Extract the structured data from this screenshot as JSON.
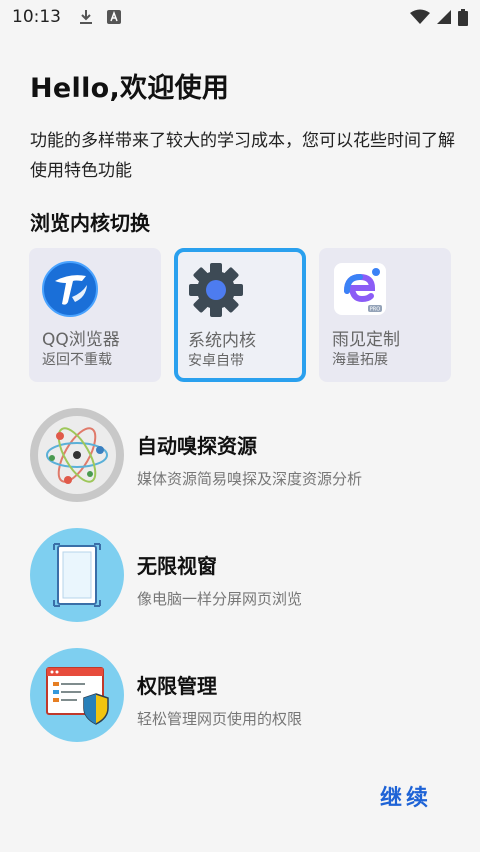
{
  "status_bar": {
    "time": "10:13",
    "icons": [
      "download-icon",
      "font-icon",
      "wifi-icon",
      "signal-icon",
      "battery-icon"
    ]
  },
  "header": {
    "title": "Hello,欢迎使用",
    "subtitle": "功能的多样带来了较大的学习成本，您可以花些时间了解使用特色功能"
  },
  "engine_section": {
    "title": "浏览内核切换",
    "selected_index": 1,
    "items": [
      {
        "name": "QQ浏览器",
        "desc": "返回不重载",
        "icon": "qq-browser-icon",
        "selected": false
      },
      {
        "name": "系统内核",
        "desc": "安卓自带",
        "icon": "gear-icon",
        "selected": true
      },
      {
        "name": "雨见定制",
        "desc": "海量拓展",
        "icon": "yujian-pro-icon",
        "selected": false
      }
    ]
  },
  "features": [
    {
      "title": "自动嗅探资源",
      "desc": "媒体资源简易嗅探及深度资源分析",
      "icon": "atom-icon"
    },
    {
      "title": "无限视窗",
      "desc": "像电脑一样分屏网页浏览",
      "icon": "window-icon"
    },
    {
      "title": "权限管理",
      "desc": "轻松管理网页使用的权限",
      "icon": "shield-permission-icon"
    }
  ],
  "actions": {
    "continue_label": "继续"
  },
  "colors": {
    "accent": "#1e63d6",
    "selected_border": "#2aa0ee",
    "card_bg": "#e9e9f2",
    "background": "#f5f5f5"
  }
}
